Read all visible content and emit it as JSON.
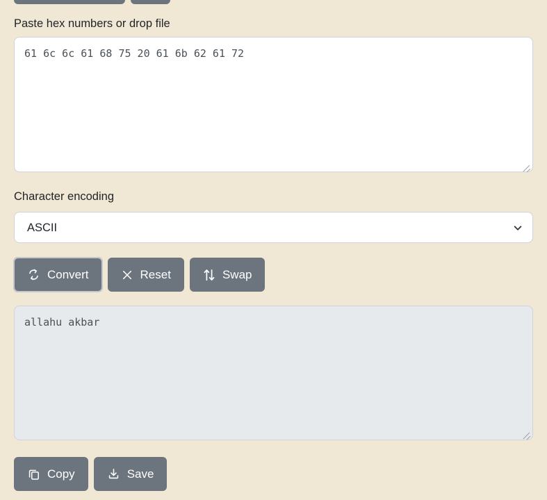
{
  "theme": {
    "page_background": "#f0e8d5",
    "button_background": "#6c757d",
    "button_text": "#ffffff",
    "input_background": "#ffffff",
    "output_background": "#e7eaed",
    "border": "#ced4da",
    "text": "#212529"
  },
  "top_cut_buttons": [
    {
      "name": "top-button-wide"
    },
    {
      "name": "top-button-narrow"
    }
  ],
  "input_section": {
    "label": "Paste hex numbers or drop file",
    "value": "61 6c 6c 61 68 75 20 61 6b 62 61 72",
    "placeholder": ""
  },
  "encoding_section": {
    "label": "Character encoding",
    "selected": "ASCII",
    "options": [
      "ASCII"
    ],
    "chevron_icon": "chevron-down-icon"
  },
  "actions": [
    {
      "id": "convert",
      "label": "Convert",
      "icon": "refresh-cycle-icon",
      "focused": true
    },
    {
      "id": "reset",
      "label": "Reset",
      "icon": "close-x-icon",
      "focused": false
    },
    {
      "id": "swap",
      "label": "Swap",
      "icon": "up-down-arrows-icon",
      "focused": false
    }
  ],
  "output_section": {
    "value": "allahu akbar",
    "placeholder": ""
  },
  "bottom_actions": [
    {
      "id": "copy",
      "label": "Copy",
      "icon": "copy-icon"
    },
    {
      "id": "save",
      "label": "Save",
      "icon": "download-icon"
    }
  ]
}
